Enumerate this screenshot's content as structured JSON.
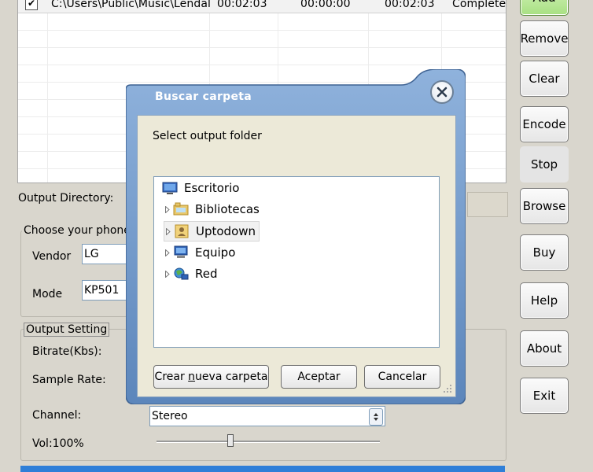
{
  "file_list": {
    "rows": [
      {
        "checked": true,
        "path": "C:\\Users\\Public\\Music\\Lendal",
        "duration": "00:02:03",
        "start": "00:00:00",
        "end": "00:02:03",
        "status": "Complete"
      }
    ]
  },
  "side_buttons": {
    "add": "Add",
    "remove": "Remove",
    "clear": "Clear",
    "encode": "Encode",
    "stop": "Stop",
    "browse": "Browse",
    "buy": "Buy",
    "help": "Help",
    "about": "About",
    "exit": "Exit"
  },
  "left_panel": {
    "output_directory_label": "Output Directory:",
    "phone_group_title": "Choose your phone v",
    "vendor_label": "Vendor",
    "vendor_value": "LG",
    "mode_label": "Mode",
    "mode_value": "KP501",
    "output_setting_title": "Output Setting",
    "bitrate_label": "Bitrate(Kbs):",
    "sample_rate_label": "Sample Rate:",
    "channel_label": "Channel:",
    "channel_value": "Stereo",
    "volume_label": "Vol:100%",
    "volume_level": 0.33
  },
  "dialog": {
    "title": "Buscar carpeta",
    "message": "Select output folder",
    "tree": [
      {
        "label": "Escritorio",
        "icon": "desktop-icon",
        "expandable": false,
        "selected": false
      },
      {
        "label": "Bibliotecas",
        "icon": "libraries-icon",
        "expandable": true,
        "selected": false
      },
      {
        "label": "Uptodown",
        "icon": "user-folder-icon",
        "expandable": true,
        "selected": true
      },
      {
        "label": "Equipo",
        "icon": "computer-icon",
        "expandable": true,
        "selected": false
      },
      {
        "label": "Red",
        "icon": "network-icon",
        "expandable": true,
        "selected": false
      }
    ],
    "buttons": {
      "new_folder_pre": "Crear ",
      "new_folder_u": "n",
      "new_folder_post": "ueva carpeta",
      "ok": "Aceptar",
      "cancel": "Cancelar"
    }
  },
  "colors": {
    "accent_blue": "#2f7fd8",
    "dialog_title_blue": "#6c95c6",
    "add_button_green": "#a8e083"
  }
}
